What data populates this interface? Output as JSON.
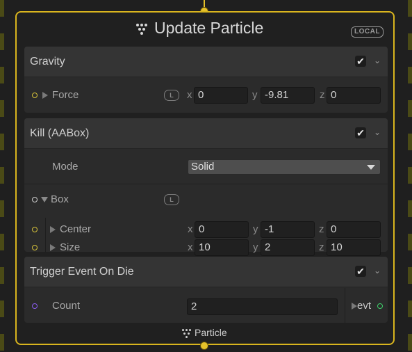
{
  "node": {
    "title": "Update Particle",
    "badge": "LOCAL",
    "footer_label": "Particle",
    "accent_color": "#d9b51e"
  },
  "gravity": {
    "title": "Gravity",
    "enabled": true,
    "force": {
      "label": "Force",
      "space_badge": "L",
      "x_label": "x",
      "x": "0",
      "y_label": "y",
      "y": "-9.81",
      "z_label": "z",
      "z": "0"
    }
  },
  "kill": {
    "title": "Kill (AABox)",
    "enabled": true,
    "mode": {
      "label": "Mode",
      "value": "Solid"
    },
    "box": {
      "label": "Box",
      "space_badge": "L",
      "center": {
        "label": "Center",
        "x_label": "x",
        "x": "0",
        "y_label": "y",
        "y": "-1",
        "z_label": "z",
        "z": "0"
      },
      "size": {
        "label": "Size",
        "x_label": "x",
        "x": "10",
        "y_label": "y",
        "y": "2",
        "z_label": "z",
        "z": "10"
      }
    }
  },
  "trigger": {
    "title": "Trigger Event On Die",
    "enabled": true,
    "count": {
      "label": "Count",
      "value": "2"
    },
    "output_label": "evt"
  },
  "icons": {
    "node_icon": "particle-dots-icon",
    "checkbox": "checkmark-icon",
    "collapse": "chevron-down-icon"
  }
}
